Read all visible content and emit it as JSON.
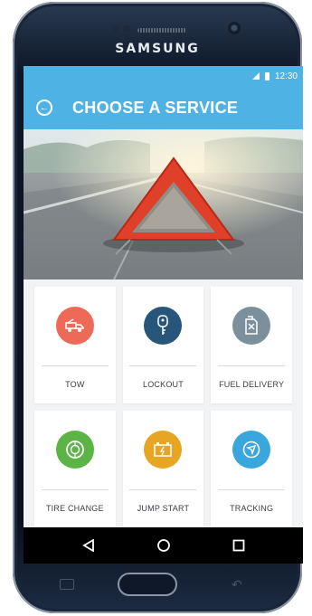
{
  "device": {
    "brand": "SAMSUNG"
  },
  "status_bar": {
    "time": "12:30"
  },
  "app_bar": {
    "title": "CHOOSE A SERVICE",
    "back_icon": "back-arrow-circle-icon"
  },
  "hero": {
    "subject": "warning-triangle-on-road"
  },
  "colors": {
    "accent": "#4fb2e4",
    "tow": "#ec6a57",
    "lockout": "#27567a",
    "fuel": "#7c8f9c",
    "tire": "#5cb446",
    "jump": "#e6a623",
    "tracking": "#3aa6de"
  },
  "services": [
    {
      "label": "TOW",
      "icon": "tow-truck-icon"
    },
    {
      "label": "LOCKOUT",
      "icon": "car-key-icon"
    },
    {
      "label": "FUEL DELIVERY",
      "icon": "fuel-can-icon"
    },
    {
      "label": "TIRE CHANGE",
      "icon": "tire-icon"
    },
    {
      "label": "JUMP START",
      "icon": "battery-icon"
    },
    {
      "label": "TRACKING",
      "icon": "location-tracking-icon"
    }
  ],
  "nav_bar": [
    "back-triangle-icon",
    "home-circle-icon",
    "recents-square-icon"
  ]
}
